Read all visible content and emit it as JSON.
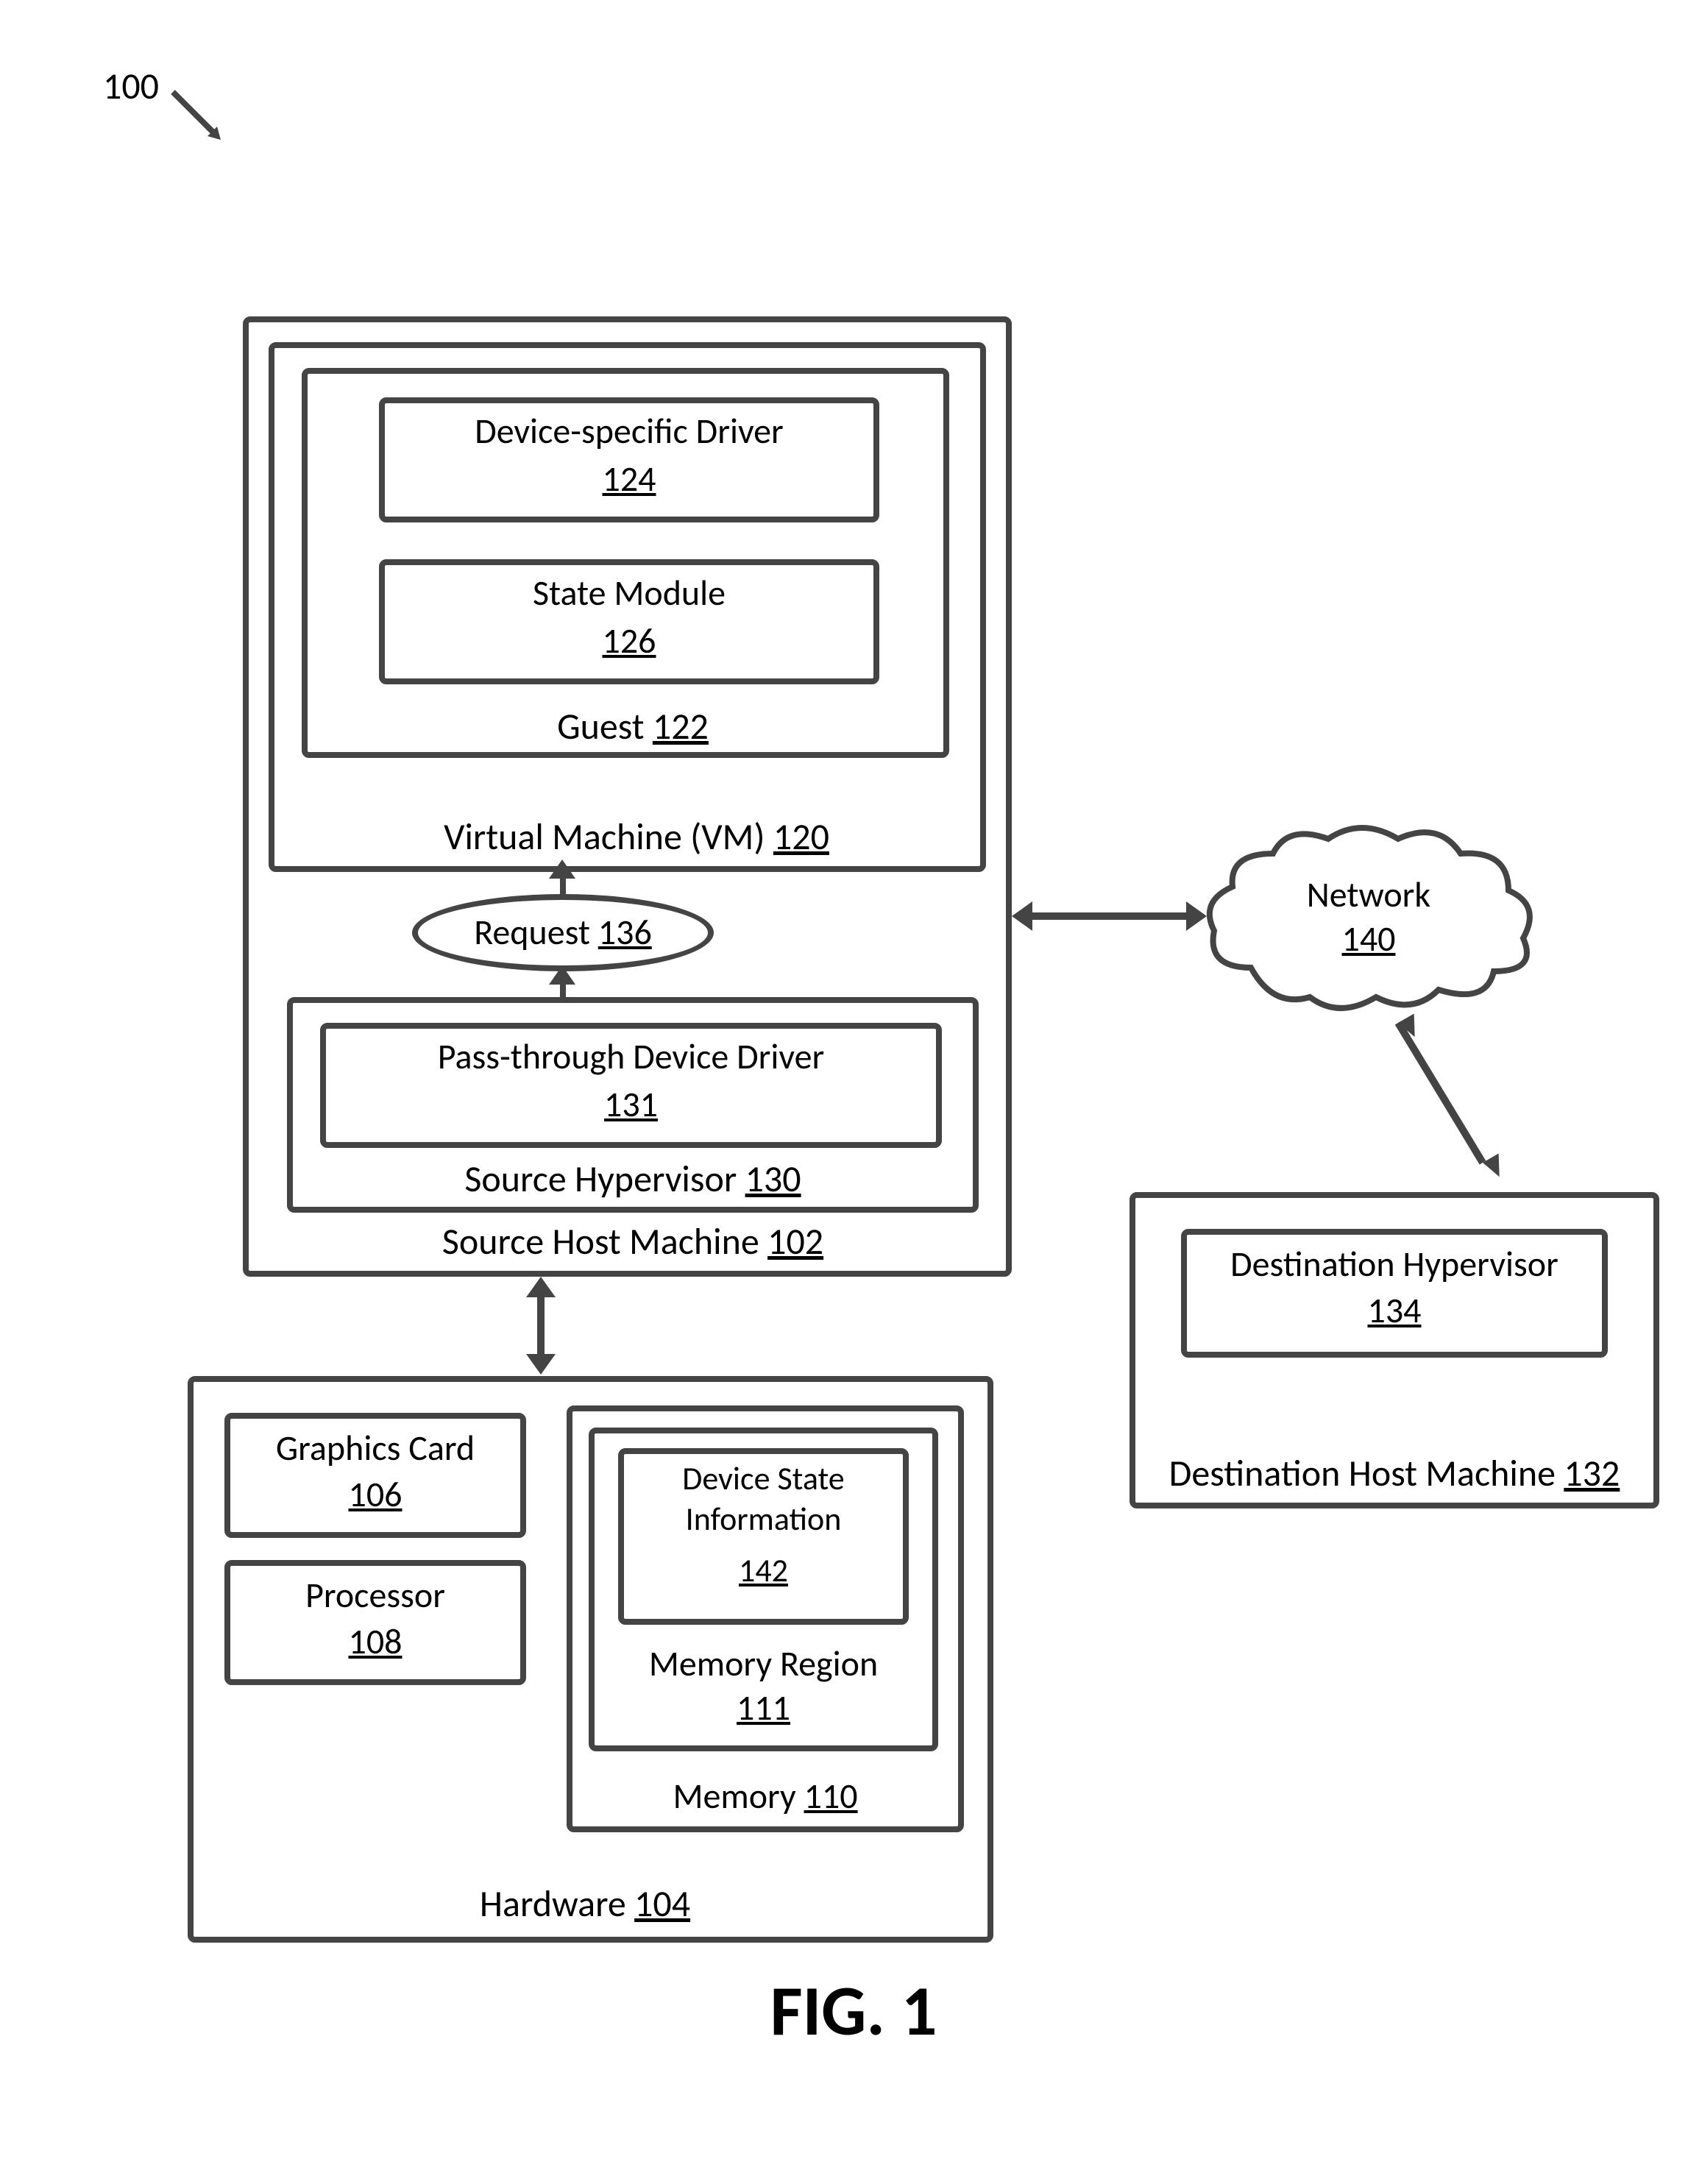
{
  "figure_caption": "FIG. 1",
  "figure_ref": {
    "label": "100"
  },
  "source_host": {
    "label": "Source Host Machine",
    "ref": "102"
  },
  "vm": {
    "label": "Virtual Machine (VM)",
    "ref": "120"
  },
  "guest": {
    "label": "Guest",
    "ref": "122"
  },
  "device_driver": {
    "label": "Device-specific Driver",
    "ref": "124"
  },
  "state_module": {
    "label": "State Module",
    "ref": "126"
  },
  "request": {
    "label": "Request",
    "ref": "136"
  },
  "source_hypervisor": {
    "label": "Source Hypervisor",
    "ref": "130"
  },
  "pt_driver": {
    "label": "Pass-through Device Driver",
    "ref": "131"
  },
  "hardware": {
    "label": "Hardware",
    "ref": "104"
  },
  "graphics_card": {
    "label": "Graphics Card",
    "ref": "106"
  },
  "processor": {
    "label": "Processor",
    "ref": "108"
  },
  "memory": {
    "label": "Memory",
    "ref": "110"
  },
  "memory_region": {
    "label": "Memory Region",
    "ref": "111"
  },
  "device_state_info": {
    "label_line1": "Device State",
    "label_line2": "Information",
    "ref": "142"
  },
  "network": {
    "label": "Network",
    "ref": "140"
  },
  "dest_host": {
    "label": "Destination Host Machine",
    "ref": "132"
  },
  "dest_hypervisor": {
    "label": "Destination Hypervisor",
    "ref": "134"
  }
}
